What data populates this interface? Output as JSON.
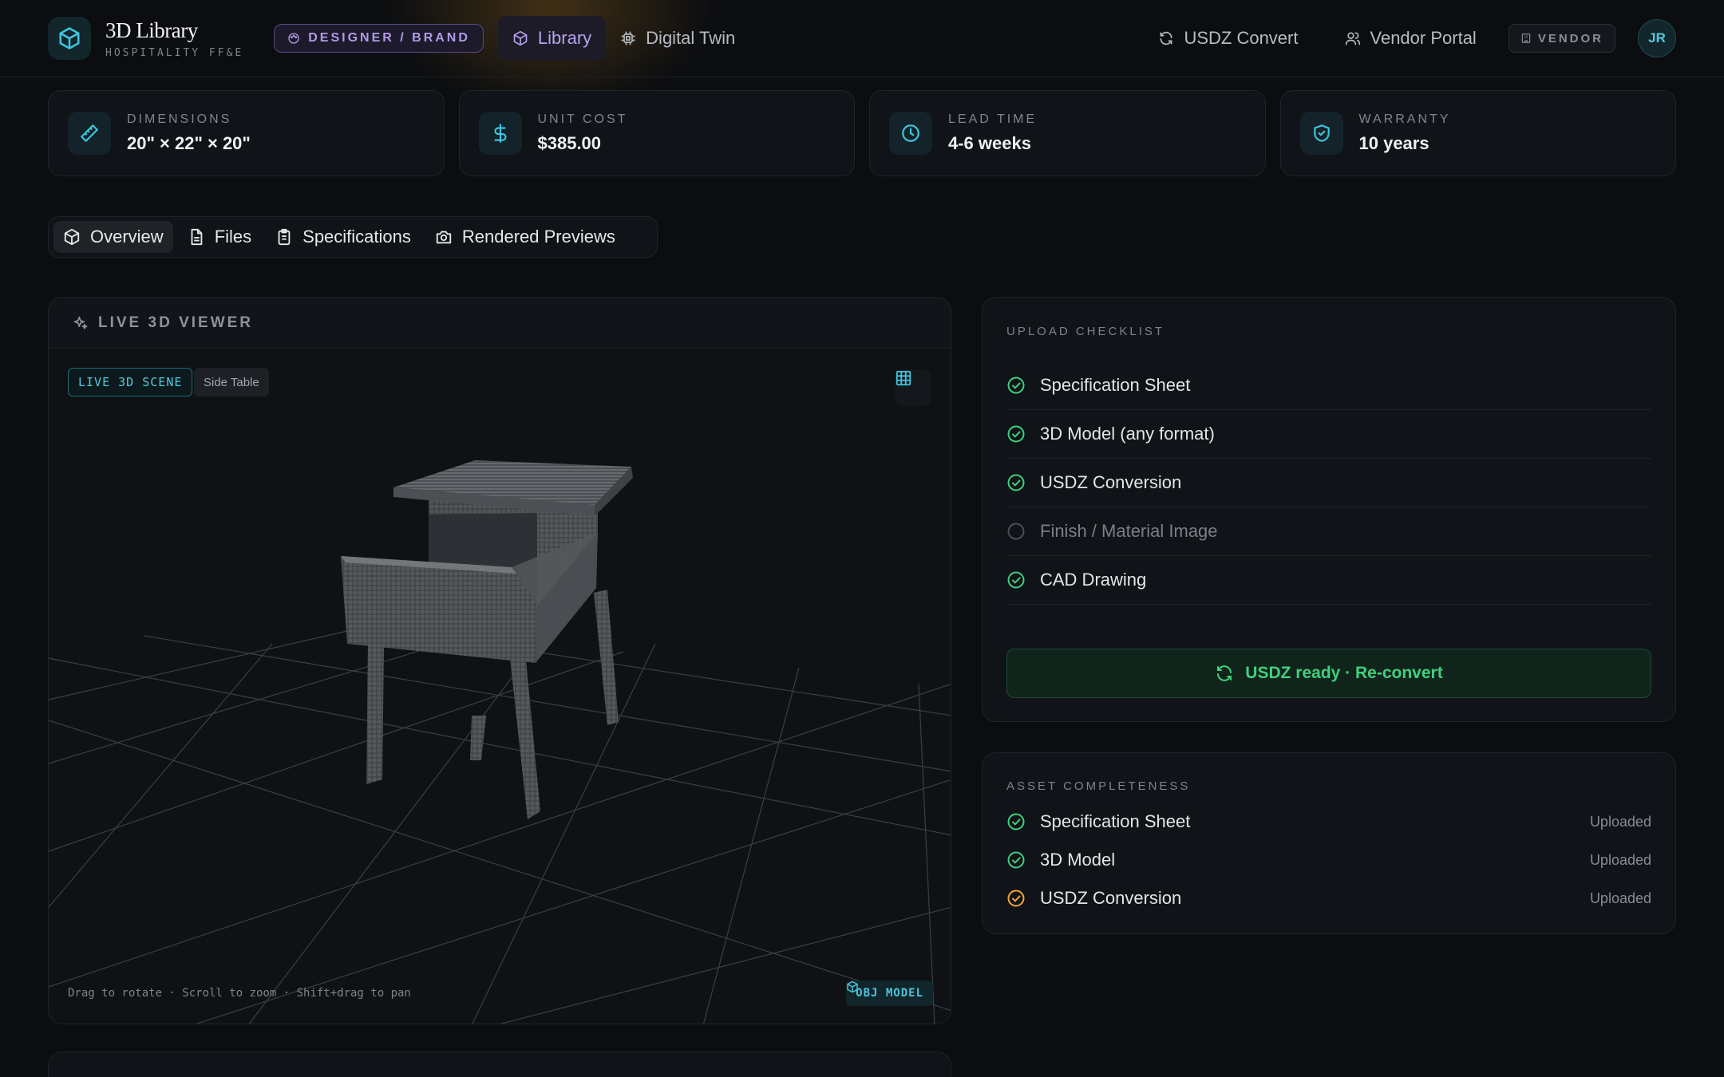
{
  "header": {
    "brand_title": "3D Library",
    "brand_subtitle": "HOSPITALITY FF&E",
    "role_label": "DESIGNER / BRAND",
    "nav": [
      {
        "label": "Library",
        "icon": "cube-icon",
        "active": true
      },
      {
        "label": "Digital Twin",
        "icon": "chip-icon",
        "active": false
      }
    ],
    "right_nav": [
      {
        "label": "USDZ Convert",
        "icon": "refresh-icon"
      },
      {
        "label": "Vendor Portal",
        "icon": "users-icon"
      }
    ],
    "vendor_label": "VENDOR",
    "avatar_initials": "JR"
  },
  "stats": [
    {
      "label": "DIMENSIONS",
      "value": "20\" × 22\" × 20\"",
      "icon": "ruler-icon"
    },
    {
      "label": "UNIT COST",
      "value": "$385.00",
      "icon": "dollar-icon"
    },
    {
      "label": "LEAD TIME",
      "value": "4-6 weeks",
      "icon": "clock-icon"
    },
    {
      "label": "WARRANTY",
      "value": "10 years",
      "icon": "shield-icon"
    }
  ],
  "tabs": [
    {
      "label": "Overview",
      "icon": "cube-icon",
      "active": true
    },
    {
      "label": "Files",
      "icon": "file-icon",
      "active": false
    },
    {
      "label": "Specifications",
      "icon": "clipboard-icon",
      "active": false
    },
    {
      "label": "Rendered Previews",
      "icon": "camera-icon",
      "active": false
    }
  ],
  "viewer": {
    "title": "LIVE 3D VIEWER",
    "scene_tag": "LIVE 3D SCENE",
    "item_name": "Side Table",
    "hint": "Drag to rotate · Scroll to zoom · Shift+drag to pan",
    "model_badge": "OBJ MODEL"
  },
  "checklist": {
    "title": "UPLOAD CHECKLIST",
    "items": [
      {
        "label": "Specification Sheet",
        "done": true
      },
      {
        "label": "3D Model (any format)",
        "done": true
      },
      {
        "label": "USDZ Conversion",
        "done": true
      },
      {
        "label": "Finish / Material Image",
        "done": false
      },
      {
        "label": "CAD Drawing",
        "done": true
      }
    ],
    "usdz_button": "USDZ ready · Re-convert"
  },
  "completeness": {
    "title": "ASSET COMPLETENESS",
    "items": [
      {
        "label": "Specification Sheet",
        "status": "Uploaded",
        "color": "#3fd07e"
      },
      {
        "label": "3D Model",
        "status": "Uploaded",
        "color": "#3fd07e"
      },
      {
        "label": "USDZ Conversion",
        "status": "Uploaded",
        "color": "#f0a63a"
      }
    ]
  },
  "colors": {
    "accent_cyan": "#56c8de",
    "accent_purple": "#b7a3f0",
    "success_green": "#3fd07e",
    "warning_orange": "#f0a63a"
  }
}
